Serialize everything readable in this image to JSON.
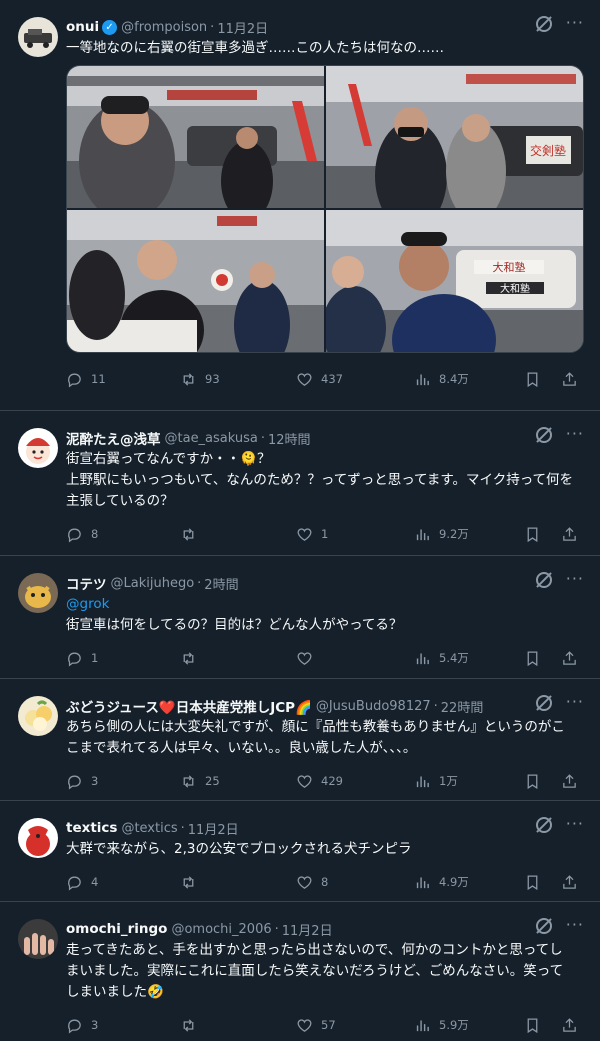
{
  "posts": [
    {
      "name": "onui",
      "verified": true,
      "handle": "@frompoison",
      "time": "11月2日",
      "text": "一等地なのに右翼の街宣車多過ぎ……この人たちは何なの……",
      "stats": {
        "replies": "11",
        "reposts": "93",
        "likes": "437",
        "views": "8.4万"
      }
    },
    {
      "name": "泥酔たえ@浅草",
      "handle": "@tae_asakusa",
      "time": "12時間",
      "text": "街宣右翼ってなんですか・・🫠？\n上野駅にもいっつもいて、なんのため？？ってずっと思ってます。マイク持って何を主張しているの？",
      "stats": {
        "replies": "8",
        "reposts": "",
        "likes": "1",
        "views": "9.2万"
      }
    },
    {
      "name": "コテツ",
      "handle": "@Lakijuhego",
      "time": "2時間",
      "mention": "@grok",
      "text": "街宣車は何をしてるの？目的は？どんな人がやってる？",
      "stats": {
        "replies": "1",
        "reposts": "",
        "likes": "",
        "views": "5.4万"
      }
    },
    {
      "name": "ぶどうジュース❤️日本共産党推しJCP🌈",
      "handle": "@JusuBudo98127",
      "time": "22時間",
      "text": "あちら側の人には大変失礼ですが、顔に『品性も教養もありません』というのがここまで表れてる人は早々、いない。。良い歳した人が、、、。",
      "stats": {
        "replies": "3",
        "reposts": "25",
        "likes": "429",
        "views": "1万"
      }
    },
    {
      "name": "textics",
      "handle": "@textics",
      "time": "11月2日",
      "text": "大群で来ながら、2,3の公安でブロックされる犬チンピラ",
      "stats": {
        "replies": "4",
        "reposts": "",
        "likes": "8",
        "views": "4.9万"
      }
    },
    {
      "name": "omochi_ringo",
      "handle": "@omochi_2006",
      "time": "11月2日",
      "text": "走ってきたあと、手を出すかと思ったら出さないので、何かのコントかと思ってしまいました。実際にこれに直面したら笑えないだろうけど、ごめんなさい。笑ってしまいました🤣",
      "stats": {
        "replies": "3",
        "reposts": "",
        "likes": "57",
        "views": "5.9万"
      }
    }
  ],
  "photo_signs": [
    "交剣塾",
    "大和塾",
    "大和塾"
  ],
  "dot": "·",
  "colors": {
    "background": "#15202b",
    "text": "#f7f9f9",
    "muted": "#8b98a5",
    "accent": "#1d9bf0",
    "border": "#38444d"
  }
}
